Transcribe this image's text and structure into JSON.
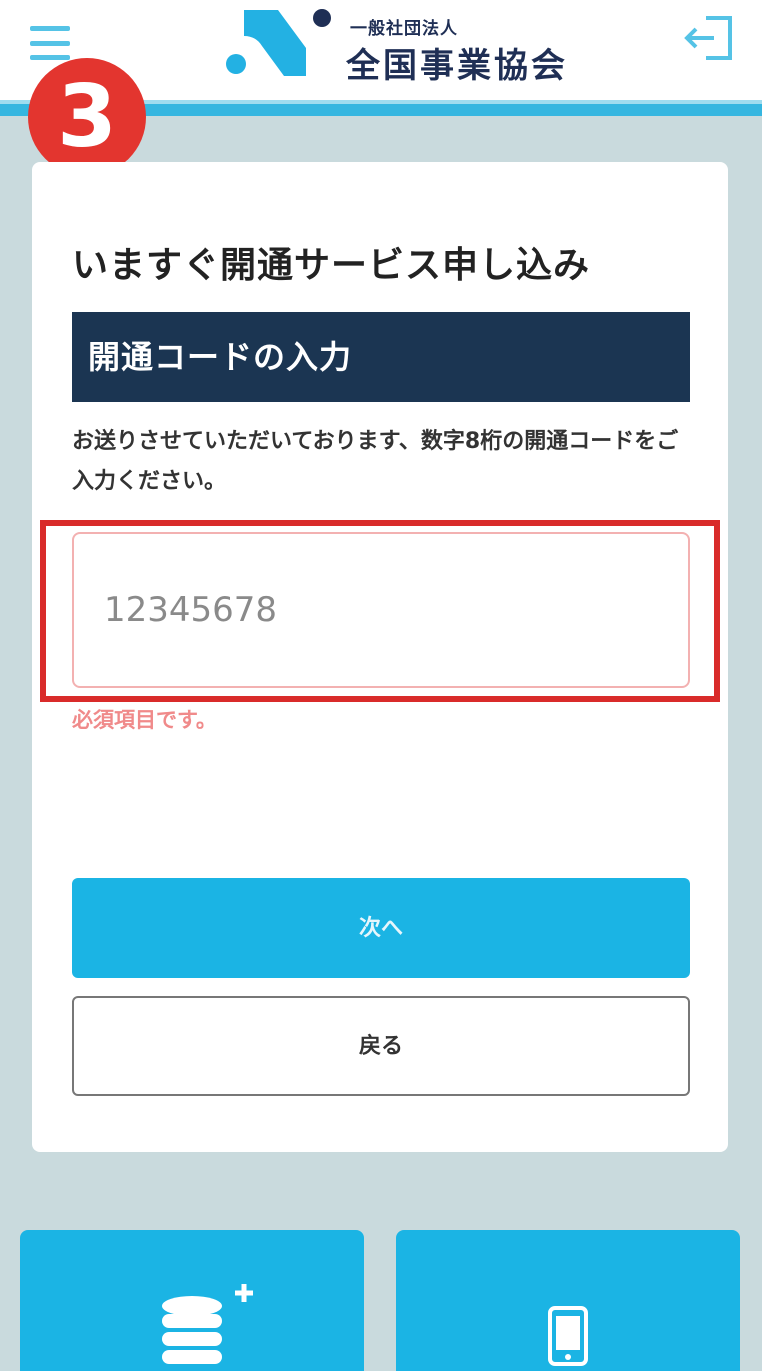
{
  "header": {
    "logo_small": "一般社団法人",
    "logo_big": "全国事業協会",
    "menu_icon": "hamburger-icon",
    "logout_icon": "logout-icon"
  },
  "step_badge": "3",
  "card": {
    "title": "いますぐ開通サービス申し込み",
    "section_heading": "開通コードの入力",
    "instruction": "お送りさせていただいております、数字8桁の開通コードをご入力ください。",
    "code_input": {
      "placeholder": "12345678",
      "value": ""
    },
    "error": "必須項目です。",
    "next_button": "次へ",
    "back_button": "戻る"
  },
  "tiles": [
    {
      "icon": "database-add-icon"
    },
    {
      "icon": "smartphone-icon"
    }
  ],
  "colors": {
    "accent": "#1bb4e4",
    "navy": "#1b3552",
    "badge": "#e3352f",
    "error": "#f08a8a"
  }
}
